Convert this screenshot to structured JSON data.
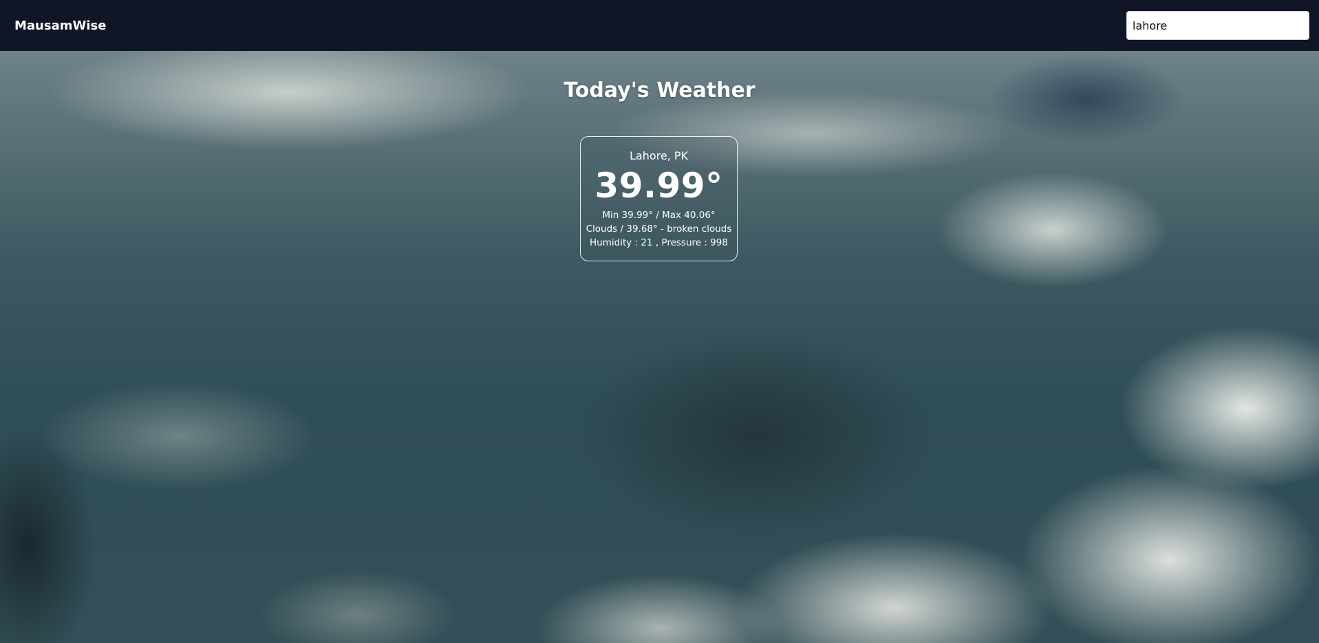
{
  "navbar": {
    "brand": "MausamWise",
    "search_value": "lahore"
  },
  "main": {
    "title": "Today's Weather"
  },
  "weather": {
    "location": "Lahore, PK",
    "temperature": "39.99°",
    "min_max": "Min 39.99° / Max 40.06°",
    "conditions": "Clouds / 39.68° - broken clouds",
    "humidity_pressure": "Humidity : 21 , Pressure : 998"
  },
  "colors": {
    "navbar_bg": "#111627",
    "text": "#ffffff"
  },
  "background_image": "cloudy-sky"
}
